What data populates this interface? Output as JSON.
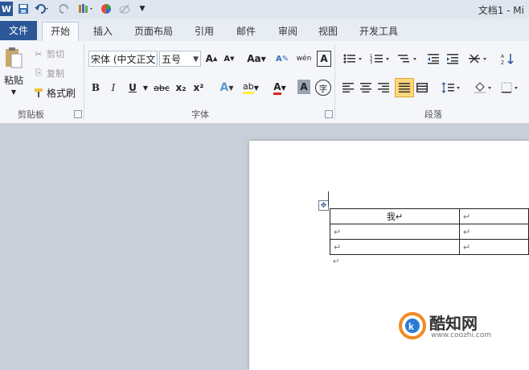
{
  "window": {
    "title": "文档1 - Mi"
  },
  "quick_access": {
    "save_icon": "save-icon",
    "undo_icon": "undo-icon",
    "redo_icon": "redo-icon",
    "customize": "▼"
  },
  "tabs": [
    {
      "label": "文件"
    },
    {
      "label": "开始"
    },
    {
      "label": "插入"
    },
    {
      "label": "页面布局"
    },
    {
      "label": "引用"
    },
    {
      "label": "邮件"
    },
    {
      "label": "审阅"
    },
    {
      "label": "视图"
    },
    {
      "label": "开发工具"
    }
  ],
  "clipboard": {
    "paste": "粘贴",
    "cut": "剪切",
    "copy": "复制",
    "format_painter": "格式刷",
    "group": "剪贴板"
  },
  "font": {
    "name": "宋体 (中文正文)",
    "size": "五号",
    "group": "字体",
    "grow": "A",
    "shrink": "A",
    "case": "Aa",
    "clear": "A",
    "bold": "B",
    "italic": "I",
    "underline": "U",
    "strike": "abc",
    "sub": "x₂",
    "sup": "x²",
    "effects": "A",
    "highlight": "ab",
    "color": "A",
    "shade": "A",
    "enclose": "字"
  },
  "paragraph": {
    "group": "段落"
  },
  "document": {
    "table": [
      [
        "我↵",
        "↵"
      ],
      [
        "↵",
        "↵"
      ],
      [
        "↵",
        "↵"
      ]
    ],
    "after_mark": "↵"
  },
  "watermark": {
    "brand": "酷知网",
    "url": "www.coozhi.com"
  },
  "colors": {
    "file_tab": "#2b5797",
    "workspace": "#c9cfd8",
    "accent": "#f08a24"
  }
}
